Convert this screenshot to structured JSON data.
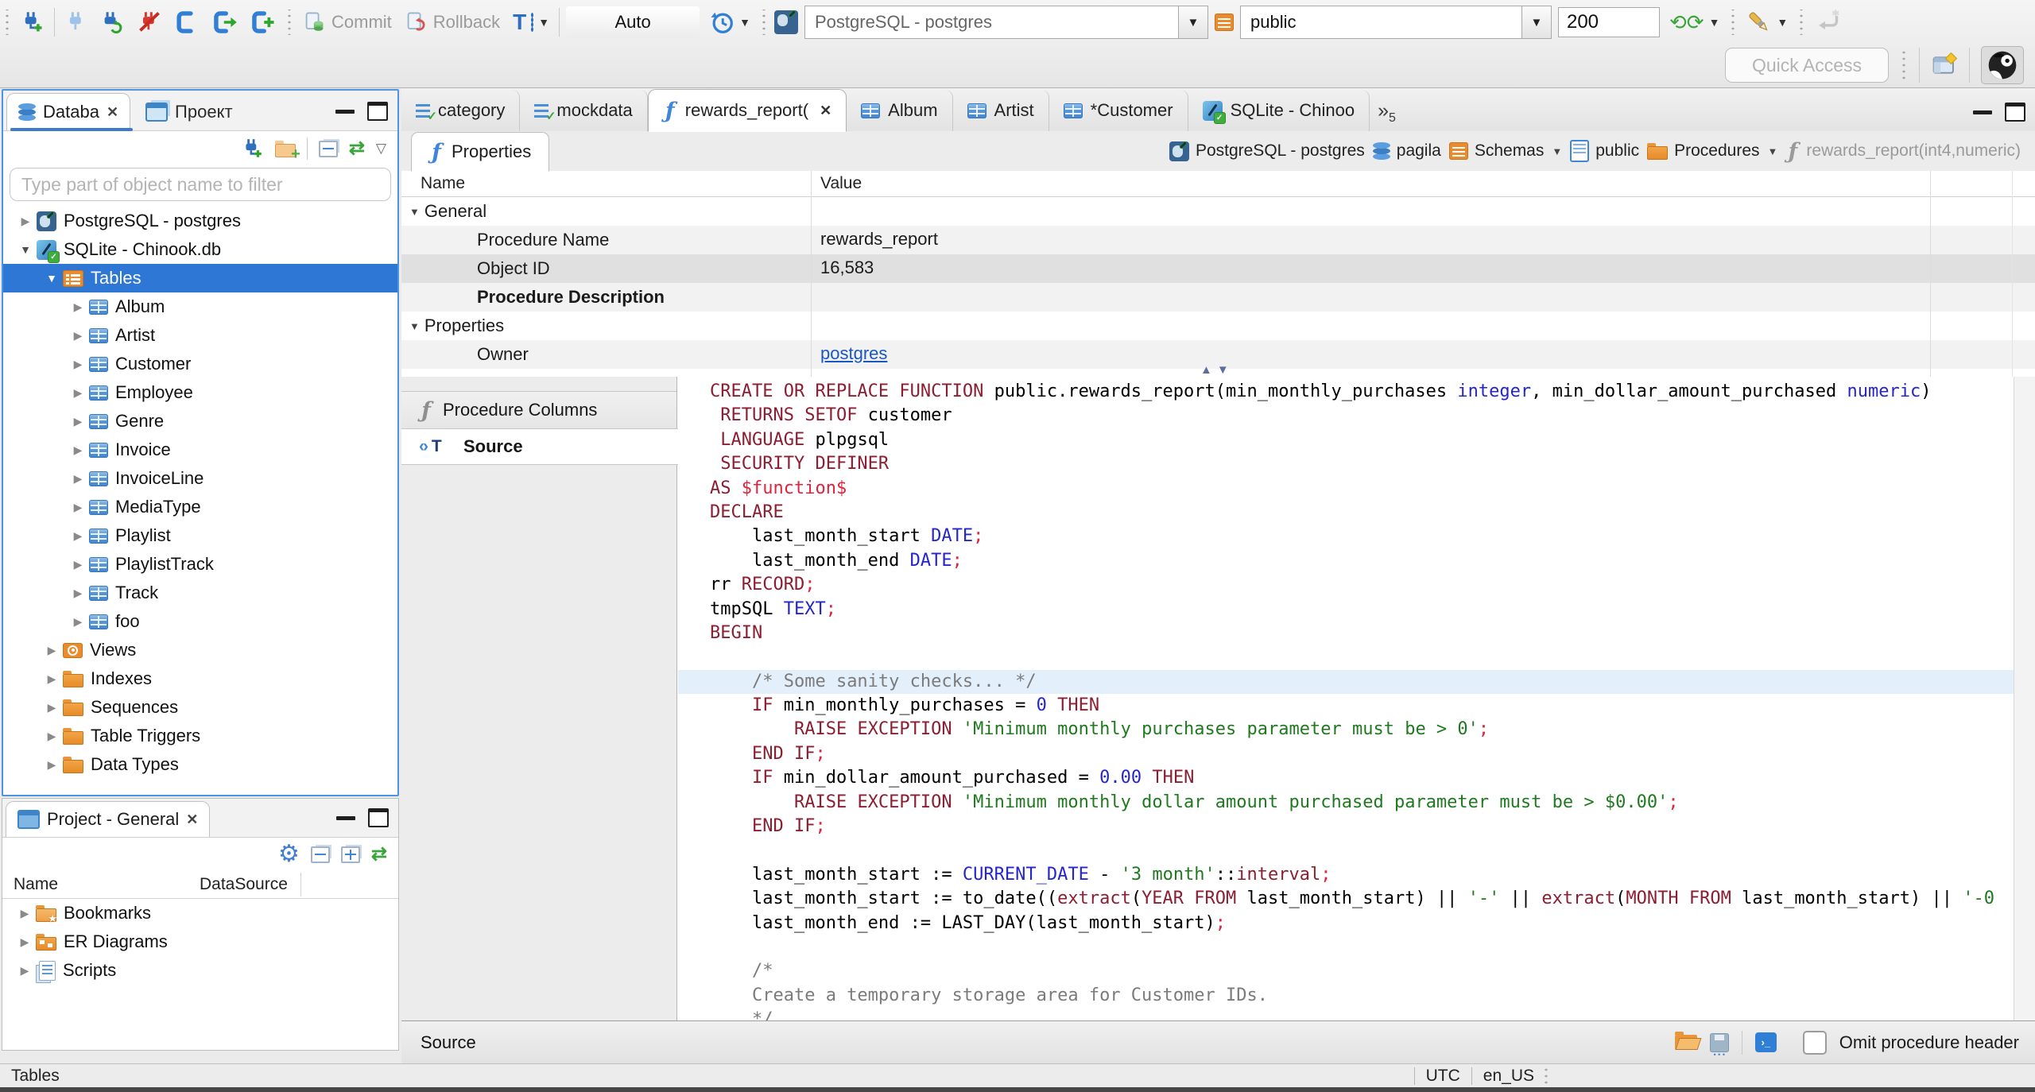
{
  "colors": {
    "selection_blue": "#2e77d4",
    "focus_border": "#4f94e4",
    "sql_keyword": "#8c1e32",
    "sql_type_number": "#2525cd",
    "sql_string": "#1f7a1f",
    "sql_comment": "#7b7b7b",
    "sql_error_red": "#e0233e",
    "link_blue": "#1a56c4"
  },
  "toolbar": {
    "commit_label": "Commit",
    "rollback_label": "Rollback",
    "auto_label": "Auto",
    "connection_value": "PostgreSQL - postgres",
    "schema_value": "public",
    "fetch_size_value": "200"
  },
  "quick_access": {
    "placeholder": "Quick Access"
  },
  "sidebar": {
    "tabs": [
      "Databa",
      "Проект"
    ],
    "filter_placeholder": "Type part of object name to filter",
    "tree": [
      {
        "label": "PostgreSQL - postgres",
        "icon": "postgres-db",
        "level": 0,
        "state": "collapsed"
      },
      {
        "label": "SQLite - Chinook.db",
        "icon": "sqlite-db",
        "level": 0,
        "state": "expanded"
      },
      {
        "label": "Tables",
        "icon": "tables-folder",
        "level": 1,
        "state": "expanded",
        "selected": true
      },
      {
        "label": "Album",
        "icon": "table",
        "level": 2,
        "state": "collapsed"
      },
      {
        "label": "Artist",
        "icon": "table",
        "level": 2,
        "state": "collapsed"
      },
      {
        "label": "Customer",
        "icon": "table",
        "level": 2,
        "state": "collapsed"
      },
      {
        "label": "Employee",
        "icon": "table",
        "level": 2,
        "state": "collapsed"
      },
      {
        "label": "Genre",
        "icon": "table",
        "level": 2,
        "state": "collapsed"
      },
      {
        "label": "Invoice",
        "icon": "table",
        "level": 2,
        "state": "collapsed"
      },
      {
        "label": "InvoiceLine",
        "icon": "table",
        "level": 2,
        "state": "collapsed"
      },
      {
        "label": "MediaType",
        "icon": "table",
        "level": 2,
        "state": "collapsed"
      },
      {
        "label": "Playlist",
        "icon": "table",
        "level": 2,
        "state": "collapsed"
      },
      {
        "label": "PlaylistTrack",
        "icon": "table",
        "level": 2,
        "state": "collapsed"
      },
      {
        "label": "Track",
        "icon": "table",
        "level": 2,
        "state": "collapsed"
      },
      {
        "label": "foo",
        "icon": "table",
        "level": 2,
        "state": "collapsed"
      },
      {
        "label": "Views",
        "icon": "views-folder",
        "level": 1,
        "state": "collapsed"
      },
      {
        "label": "Indexes",
        "icon": "folder",
        "level": 1,
        "state": "collapsed"
      },
      {
        "label": "Sequences",
        "icon": "folder",
        "level": 1,
        "state": "collapsed"
      },
      {
        "label": "Table Triggers",
        "icon": "folder",
        "level": 1,
        "state": "collapsed"
      },
      {
        "label": "Data Types",
        "icon": "folder",
        "level": 1,
        "state": "collapsed"
      }
    ]
  },
  "project_panel": {
    "title": "Project - General",
    "columns": [
      "Name",
      "DataSource"
    ],
    "items": [
      {
        "label": "Bookmarks",
        "icon": "bookmarks-folder"
      },
      {
        "label": "ER Diagrams",
        "icon": "er-folder"
      },
      {
        "label": "Scripts",
        "icon": "scripts"
      }
    ]
  },
  "editor": {
    "tabs": [
      {
        "label": "category",
        "icon": "script"
      },
      {
        "label": "mockdata",
        "icon": "script"
      },
      {
        "label": "rewards_report(",
        "icon": "function",
        "active": true,
        "closable": true
      },
      {
        "label": "Album",
        "icon": "table"
      },
      {
        "label": "Artist",
        "icon": "table"
      },
      {
        "label": "*Customer",
        "icon": "table"
      },
      {
        "label": "SQLite - Chinoo",
        "icon": "sqlite-db"
      }
    ],
    "overflow_count": "5"
  },
  "object_editor": {
    "properties_tab_label": "Properties",
    "breadcrumb": [
      {
        "label": "PostgreSQL - postgres",
        "icon": "postgres-db"
      },
      {
        "label": "pagila",
        "icon": "database"
      },
      {
        "label": "Schemas",
        "icon": "schemas",
        "dropdown": true
      },
      {
        "label": "public",
        "icon": "page"
      },
      {
        "label": "Procedures",
        "icon": "folder",
        "dropdown": true
      },
      {
        "label": "rewards_report(int4,numeric)",
        "icon": "function",
        "muted": true
      }
    ],
    "table": {
      "columns": [
        "Name",
        "Value"
      ],
      "rows": [
        {
          "name": "General",
          "group": true,
          "shade": "white"
        },
        {
          "name": "Procedure Name",
          "value": "rewards_report",
          "shade": "light"
        },
        {
          "name": "Object ID",
          "value": "16,583",
          "shade": "selected"
        },
        {
          "name": "Procedure Description",
          "bold": true,
          "shade": "light"
        },
        {
          "name": "Properties",
          "group": true,
          "shade": "white"
        },
        {
          "name": "Owner",
          "value": "postgres",
          "link": true,
          "shade": "light"
        }
      ]
    },
    "subtabs": [
      {
        "label": "Procedure Columns",
        "icon": "function-gray"
      },
      {
        "label": "Source",
        "icon": "source",
        "selected": true
      }
    ],
    "source_bar_label": "Source",
    "omit_checkbox_label": "Omit procedure header"
  },
  "code_lines": [
    {
      "tk": [
        [
          "k",
          "CREATE OR REPLACE FUNCTION"
        ],
        [
          "p",
          " public.rewards_report(min_monthly_purchases "
        ],
        [
          "t",
          "integer"
        ],
        [
          "p",
          ", min_dollar_amount_purchased "
        ],
        [
          "t",
          "numeric"
        ],
        [
          "p",
          ")"
        ]
      ]
    },
    {
      "tk": [
        [
          "p",
          " "
        ],
        [
          "k",
          "RETURNS SETOF"
        ],
        [
          "p",
          " customer"
        ]
      ]
    },
    {
      "tk": [
        [
          "p",
          " "
        ],
        [
          "k",
          "LANGUAGE"
        ],
        [
          "p",
          " plpgsql"
        ]
      ]
    },
    {
      "tk": [
        [
          "p",
          " "
        ],
        [
          "k",
          "SECURITY DEFINER"
        ]
      ]
    },
    {
      "tk": [
        [
          "k",
          "AS"
        ],
        [
          "p",
          " "
        ],
        [
          "r",
          "$function$"
        ]
      ]
    },
    {
      "tk": [
        [
          "k",
          "DECLARE"
        ]
      ]
    },
    {
      "tk": [
        [
          "p",
          "    last_month_start "
        ],
        [
          "t",
          "DATE"
        ],
        [
          "r",
          ";"
        ]
      ]
    },
    {
      "tk": [
        [
          "p",
          "    last_month_end "
        ],
        [
          "t",
          "DATE"
        ],
        [
          "r",
          ";"
        ]
      ]
    },
    {
      "tk": [
        [
          "p",
          "rr "
        ],
        [
          "k",
          "RECORD"
        ],
        [
          "r",
          ";"
        ]
      ]
    },
    {
      "tk": [
        [
          "p",
          "tmpSQL "
        ],
        [
          "t",
          "TEXT"
        ],
        [
          "r",
          ";"
        ]
      ]
    },
    {
      "tk": [
        [
          "k",
          "BEGIN"
        ]
      ]
    },
    {
      "tk": []
    },
    {
      "hl": true,
      "tk": [
        [
          "p",
          "    "
        ],
        [
          "c",
          "/* Some sanity checks... */"
        ]
      ]
    },
    {
      "tk": [
        [
          "p",
          "    "
        ],
        [
          "k",
          "IF"
        ],
        [
          "p",
          " min_monthly_purchases = "
        ],
        [
          "t",
          "0"
        ],
        [
          "p",
          " "
        ],
        [
          "k",
          "THEN"
        ]
      ]
    },
    {
      "tk": [
        [
          "p",
          "        "
        ],
        [
          "k",
          "RAISE EXCEPTION"
        ],
        [
          "p",
          " "
        ],
        [
          "s",
          "'Minimum monthly purchases parameter must be > 0'"
        ],
        [
          "r",
          ";"
        ]
      ]
    },
    {
      "tk": [
        [
          "p",
          "    "
        ],
        [
          "k",
          "END IF"
        ],
        [
          "r",
          ";"
        ]
      ]
    },
    {
      "tk": [
        [
          "p",
          "    "
        ],
        [
          "k",
          "IF"
        ],
        [
          "p",
          " min_dollar_amount_purchased = "
        ],
        [
          "t",
          "0.00"
        ],
        [
          "p",
          " "
        ],
        [
          "k",
          "THEN"
        ]
      ]
    },
    {
      "tk": [
        [
          "p",
          "        "
        ],
        [
          "k",
          "RAISE EXCEPTION"
        ],
        [
          "p",
          " "
        ],
        [
          "s",
          "'Minimum monthly dollar amount purchased parameter must be > $0.00'"
        ],
        [
          "r",
          ";"
        ]
      ]
    },
    {
      "tk": [
        [
          "p",
          "    "
        ],
        [
          "k",
          "END IF"
        ],
        [
          "r",
          ";"
        ]
      ]
    },
    {
      "tk": []
    },
    {
      "tk": [
        [
          "p",
          "    last_month_start := "
        ],
        [
          "t",
          "CURRENT_DATE"
        ],
        [
          "p",
          " - "
        ],
        [
          "s",
          "'3 month'"
        ],
        [
          "p",
          "::"
        ],
        [
          "k",
          "interval"
        ],
        [
          "r",
          ";"
        ]
      ]
    },
    {
      "tk": [
        [
          "p",
          "    last_month_start := to_date(("
        ],
        [
          "k",
          "extract"
        ],
        [
          "p",
          "("
        ],
        [
          "k",
          "YEAR FROM"
        ],
        [
          "p",
          " last_month_start) || "
        ],
        [
          "s",
          "'-'"
        ],
        [
          "p",
          " || "
        ],
        [
          "k",
          "extract"
        ],
        [
          "p",
          "("
        ],
        [
          "k",
          "MONTH FROM"
        ],
        [
          "p",
          " last_month_start) || "
        ],
        [
          "s",
          "'-0"
        ]
      ]
    },
    {
      "tk": [
        [
          "p",
          "    last_month_end := LAST_DAY(last_month_start)"
        ],
        [
          "r",
          ";"
        ]
      ]
    },
    {
      "tk": []
    },
    {
      "tk": [
        [
          "p",
          "    "
        ],
        [
          "c",
          "/*"
        ]
      ]
    },
    {
      "tk": [
        [
          "p",
          "    "
        ],
        [
          "c",
          "Create a temporary storage area for Customer IDs."
        ]
      ]
    },
    {
      "tk": [
        [
          "p",
          "    "
        ],
        [
          "c",
          "*/"
        ]
      ]
    }
  ],
  "status_bar": {
    "left": "Tables",
    "timezone": "UTC",
    "locale": "en_US"
  }
}
